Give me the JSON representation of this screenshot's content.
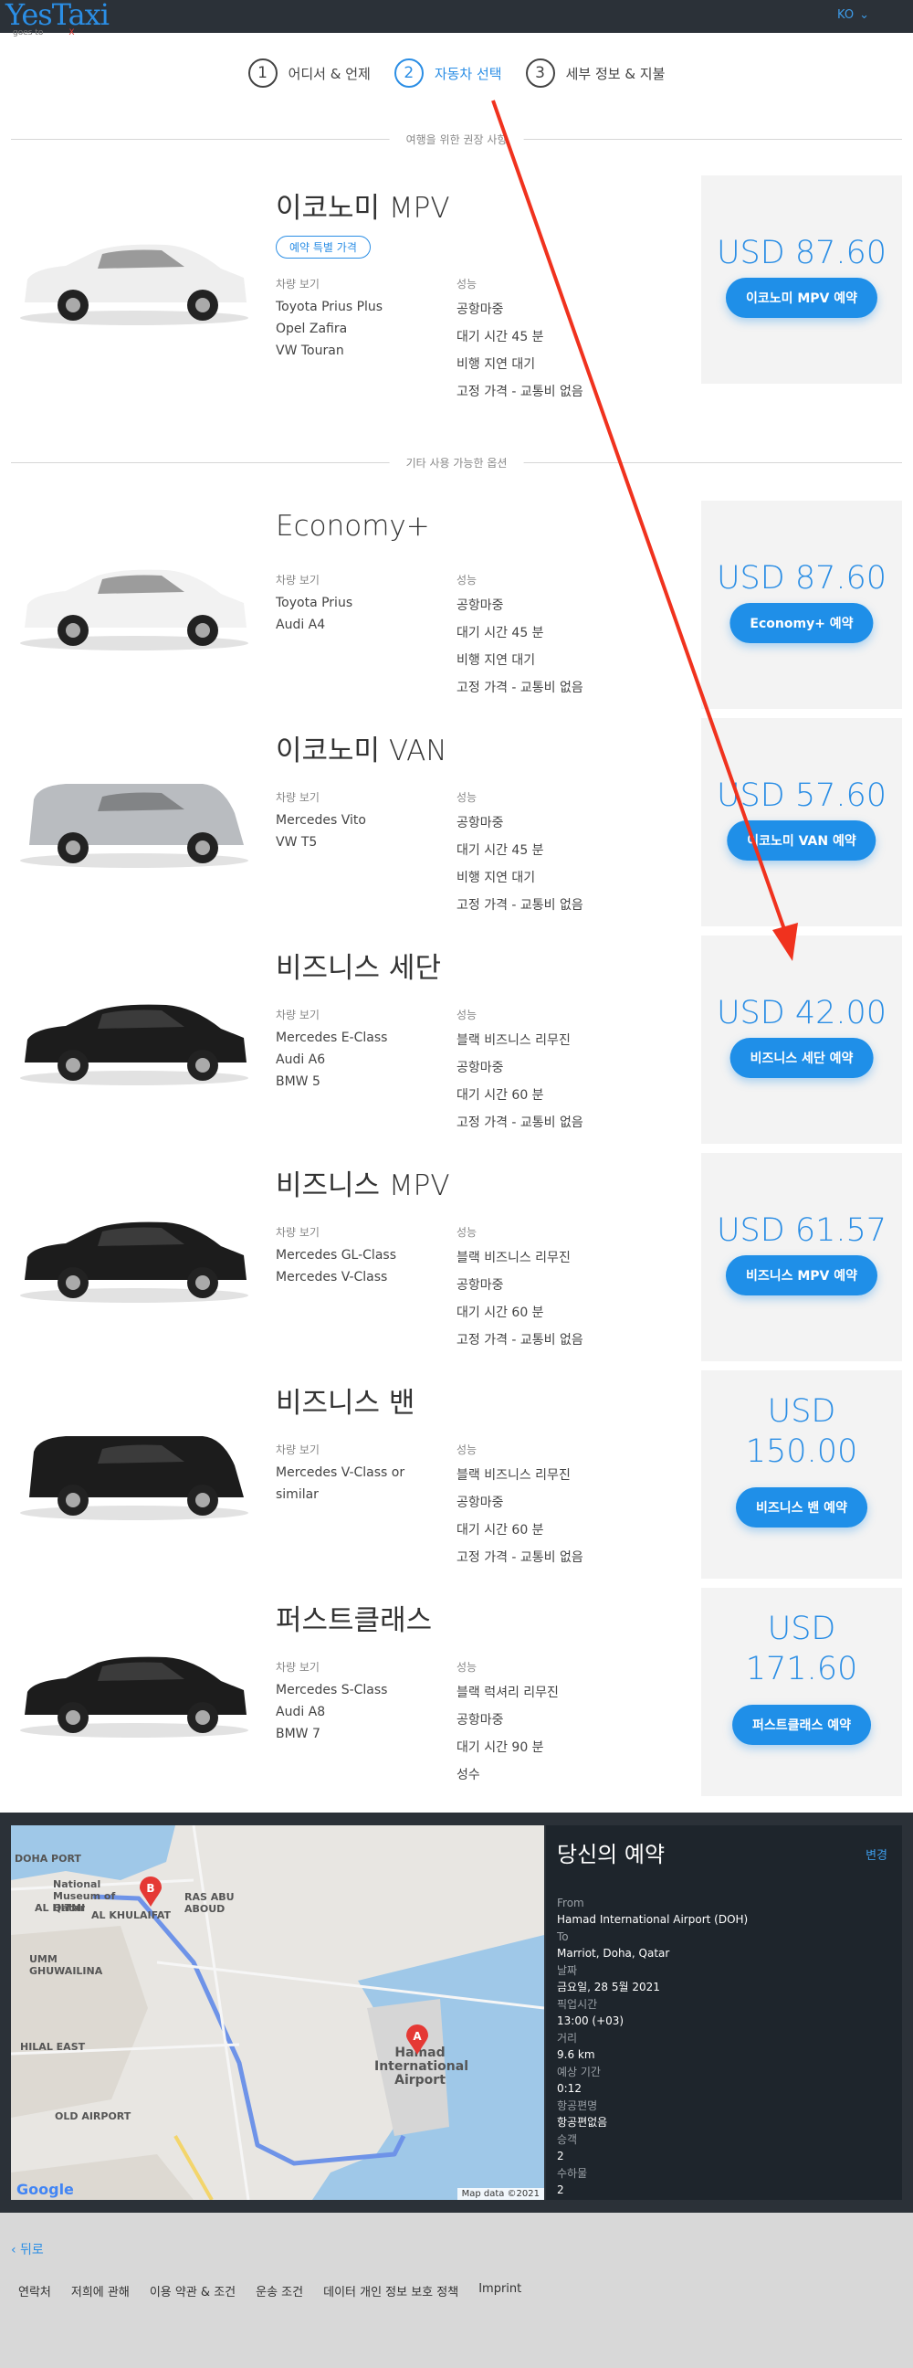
{
  "header": {
    "logo": "YesTaxi",
    "logo_sub": "goes to",
    "lang": "KO"
  },
  "steps": [
    {
      "num": "1",
      "label": "어디서 & 언제"
    },
    {
      "num": "2",
      "label": "자동차 선택"
    },
    {
      "num": "3",
      "label": "세부 정보 & 지불"
    }
  ],
  "sections": {
    "recommended": "여행을 위한 권장 사항",
    "other": "기타 사용 가능한 옵션"
  },
  "labels": {
    "examples": "차량 보기",
    "features": "성능"
  },
  "cars": [
    {
      "title": "이코노미 MPV",
      "badge": "예약 특별 가격",
      "examples": [
        "Toyota Prius Plus",
        "Opel Zafira",
        "VW Touran"
      ],
      "features": [
        "공항마중",
        "대기 시간 45 분",
        "비행 지연 대기",
        "고정 가격 - 교통비 없음"
      ],
      "price": "USD 87.60",
      "button": "이코노미 MPV 예약",
      "color": "#eeeeee"
    },
    {
      "title": "Economy+",
      "badge": "",
      "examples": [
        "Toyota Prius",
        "Audi A4"
      ],
      "features": [
        "공항마중",
        "대기 시간 45 분",
        "비행 지연 대기",
        "고정 가격 - 교통비 없음"
      ],
      "price": "USD 87.60",
      "button": "Economy+ 예약",
      "color": "#f2f2f2"
    },
    {
      "title": "이코노미 VAN",
      "badge": "",
      "examples": [
        "Mercedes Vito",
        "VW T5"
      ],
      "features": [
        "공항마중",
        "대기 시간 45 분",
        "비행 지연 대기",
        "고정 가격 - 교통비 없음"
      ],
      "price": "USD 57.60",
      "button": "이코노미 VAN 예약",
      "color": "#b9bcc0"
    },
    {
      "title": "비즈니스 세단",
      "badge": "",
      "examples": [
        "Mercedes E-Class",
        "Audi A6",
        "BMW 5"
      ],
      "features": [
        "블랙 비즈니스 리무진",
        "공항마중",
        "대기 시간 60 분",
        "고정 가격 - 교통비 없음"
      ],
      "price": "USD 42.00",
      "button": "비즈니스 세단 예약",
      "color": "#1c1c1c"
    },
    {
      "title": "비즈니스 MPV",
      "badge": "",
      "examples": [
        "Mercedes GL-Class",
        "Mercedes V-Class"
      ],
      "features": [
        "블랙 비즈니스 리무진",
        "공항마중",
        "대기 시간 60 분",
        "고정 가격 - 교통비 없음"
      ],
      "price": "USD 61.57",
      "button": "비즈니스 MPV 예약",
      "color": "#1c1c1c"
    },
    {
      "title": "비즈니스 밴",
      "badge": "",
      "examples": [
        "Mercedes V-Class or",
        "similar"
      ],
      "features": [
        "블랙 비즈니스 리무진",
        "공항마중",
        "대기 시간 60 분",
        "고정 가격 - 교통비 없음"
      ],
      "price_line1": "USD",
      "price_line2": "150.00",
      "button": "비즈니스 밴 예약",
      "color": "#1c1c1c"
    },
    {
      "title": "퍼스트클래스",
      "badge": "",
      "examples": [
        "Mercedes S-Class",
        "Audi A8",
        "BMW 7"
      ],
      "features": [
        "블랙 럭셔리 리무진",
        "공항마중",
        "대기 시간 90 분",
        "성수"
      ],
      "price_line1": "USD",
      "price_line2": "171.60",
      "button": "퍼스트클래스 예약",
      "color": "#1c1c1c"
    }
  ],
  "booking": {
    "title": "당신의 예약",
    "change": "변경",
    "rows": [
      {
        "k": "From",
        "v": "Hamad International Airport (DOH)"
      },
      {
        "k": "To",
        "v": "Marriot, Doha, Qatar"
      },
      {
        "k": "날짜",
        "v": "금요일, 28 5월 2021"
      },
      {
        "k": "픽업시간",
        "v": "13:00 (+03)"
      },
      {
        "k": "거리",
        "v": "9.6 km"
      },
      {
        "k": "예상 기간",
        "v": "0:12"
      },
      {
        "k": "항공편명",
        "v": "항공편없음"
      },
      {
        "k": "승객",
        "v": "2"
      },
      {
        "k": "수하물",
        "v": "2"
      }
    ]
  },
  "map": {
    "credit": "Map data ©2021",
    "google": "Google",
    "labels": [
      "DOHA PORT",
      "National Museum of Qatar",
      "AL HITMI",
      "AL KHULAIFAT",
      "RAS ABU ABOUD",
      "UMM GHUWAILINA",
      "HILAL EAST",
      "OLD AIRPORT",
      "Hamad International Airport"
    ],
    "pin_a": "A",
    "pin_b": "B"
  },
  "footer": {
    "back": "‹ 뒤로",
    "links": [
      "연락처",
      "저희에 관해",
      "이용 약관 & 조건",
      "운송 조건",
      "데이터 개인 정보 보호 정책",
      "Imprint"
    ]
  },
  "colors": {
    "accent": "#1f8fe8",
    "arrow": "#f0321e",
    "dark": "#2b3138"
  }
}
